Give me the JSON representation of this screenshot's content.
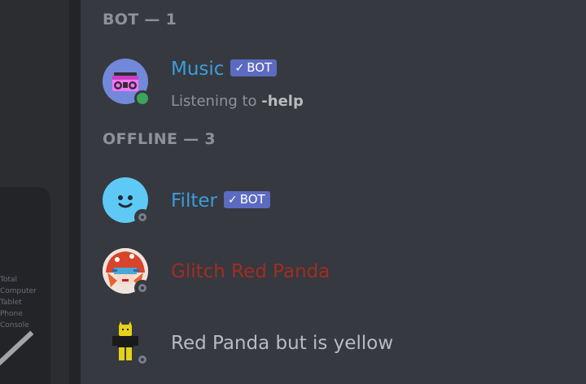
{
  "left": {
    "devices": [
      "Total",
      "Computer",
      "Tablet",
      "Phone",
      "Console"
    ]
  },
  "sections": [
    {
      "header": "BOT — 1",
      "members": [
        {
          "name": "Music",
          "name_color": "#3b9ddd",
          "tag": "BOT",
          "tag_check": "✓",
          "status": "online",
          "activity_prefix": "Listening to ",
          "activity_bold": "-help",
          "avatar_icon": "boombox-icon"
        }
      ]
    },
    {
      "header": "OFFLINE — 3",
      "members": [
        {
          "name": "Filter",
          "name_color": "#3b9ddd",
          "tag": "BOT",
          "tag_check": "✓",
          "status": "offline",
          "avatar_icon": "smiley-face-icon"
        },
        {
          "name": "Glitch Red Panda",
          "name_color": "#a12d23",
          "status": "offline",
          "avatar_icon": "red-panda-avatar"
        },
        {
          "name": "Red Panda but is yellow",
          "name_color": "#b9bbbe",
          "status": "offline",
          "avatar_icon": "yellow-figure-avatar"
        }
      ]
    }
  ]
}
